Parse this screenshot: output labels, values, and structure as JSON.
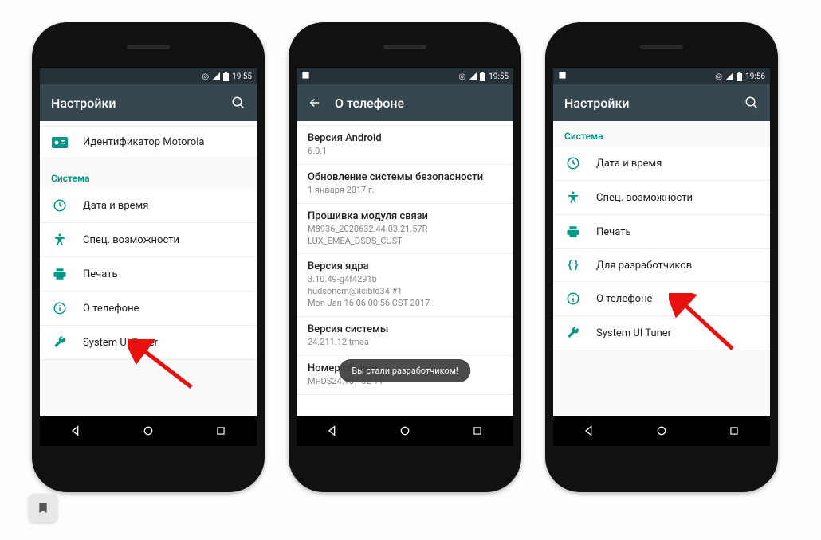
{
  "phone1": {
    "status": {
      "time": "19:55"
    },
    "appbar": {
      "title": "Настройки"
    },
    "top_item": {
      "label": "Идентификатор Motorola"
    },
    "section": "Система",
    "items": [
      {
        "label": "Дата и время"
      },
      {
        "label": "Спец. возможности"
      },
      {
        "label": "Печать"
      },
      {
        "label": "О телефоне"
      },
      {
        "label": "System UI Tuner"
      }
    ]
  },
  "phone2": {
    "status": {
      "time": "19:55"
    },
    "appbar": {
      "title": "О телефоне"
    },
    "rows": [
      {
        "title": "Версия Android",
        "sub": "6.0.1"
      },
      {
        "title": "Обновление системы безопасности",
        "sub": "1 января 2017 г."
      },
      {
        "title": "Прошивка модуля связи",
        "sub": "M8936_2020632.44.03.21.57R\nLUX_EMEA_DSDS_CUST"
      },
      {
        "title": "Версия ядра",
        "sub": "3.10.49-g4f4291b\nhudsoncm@ilclbld34 #1\nMon Jan 16 06:00:56 CST 2017"
      },
      {
        "title": "Версия системы",
        "sub": "24.211.12            tmea"
      },
      {
        "title": "Номер сборки",
        "sub": "MPDS24.107-52-11"
      }
    ],
    "toast": "Вы стали разработчиком!"
  },
  "phone3": {
    "status": {
      "time": "19:56"
    },
    "appbar": {
      "title": "Настройки"
    },
    "section": "Система",
    "items": [
      {
        "label": "Дата и время"
      },
      {
        "label": "Спец. возможности"
      },
      {
        "label": "Печать"
      },
      {
        "label": "Для разработчиков"
      },
      {
        "label": "О телефоне"
      },
      {
        "label": "System UI Tuner"
      }
    ]
  }
}
